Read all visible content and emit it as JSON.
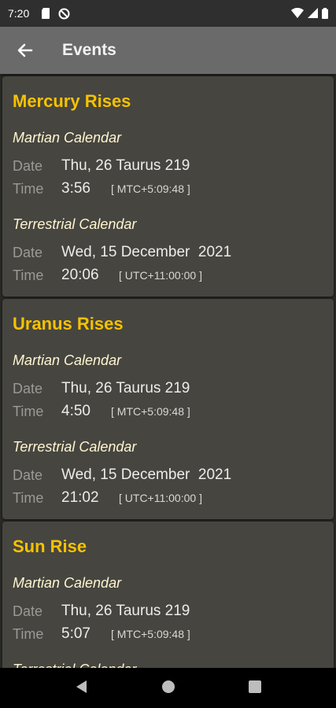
{
  "status": {
    "time": "7:20"
  },
  "appbar": {
    "title": "Events"
  },
  "labels": {
    "martian": "Martian Calendar",
    "terrestrial": "Terrestrial Calendar",
    "date": "Date",
    "time": "Time"
  },
  "events": [
    {
      "title": "Mercury Rises",
      "mars": {
        "date": "Thu, 26 Taurus 219",
        "time": "3:56",
        "tz": "[ MTC+5:09:48 ]"
      },
      "earth": {
        "date": "Wed, 15 December  2021",
        "time": "20:06",
        "tz": "[ UTC+11:00:00 ]"
      }
    },
    {
      "title": "Uranus Rises",
      "mars": {
        "date": "Thu, 26 Taurus 219",
        "time": "4:50",
        "tz": "[ MTC+5:09:48 ]"
      },
      "earth": {
        "date": "Wed, 15 December  2021",
        "time": "21:02",
        "tz": "[ UTC+11:00:00 ]"
      }
    },
    {
      "title": "Sun Rise",
      "mars": {
        "date": "Thu, 26 Taurus 219",
        "time": "5:07",
        "tz": "[ MTC+5:09:48 ]"
      },
      "earth": {
        "date": "",
        "time": "",
        "tz": ""
      }
    }
  ],
  "icons": {
    "back": "arrow-back-icon",
    "nav_back": "triangle-back-icon",
    "nav_home": "circle-home-icon",
    "nav_recents": "square-recents-icon"
  }
}
